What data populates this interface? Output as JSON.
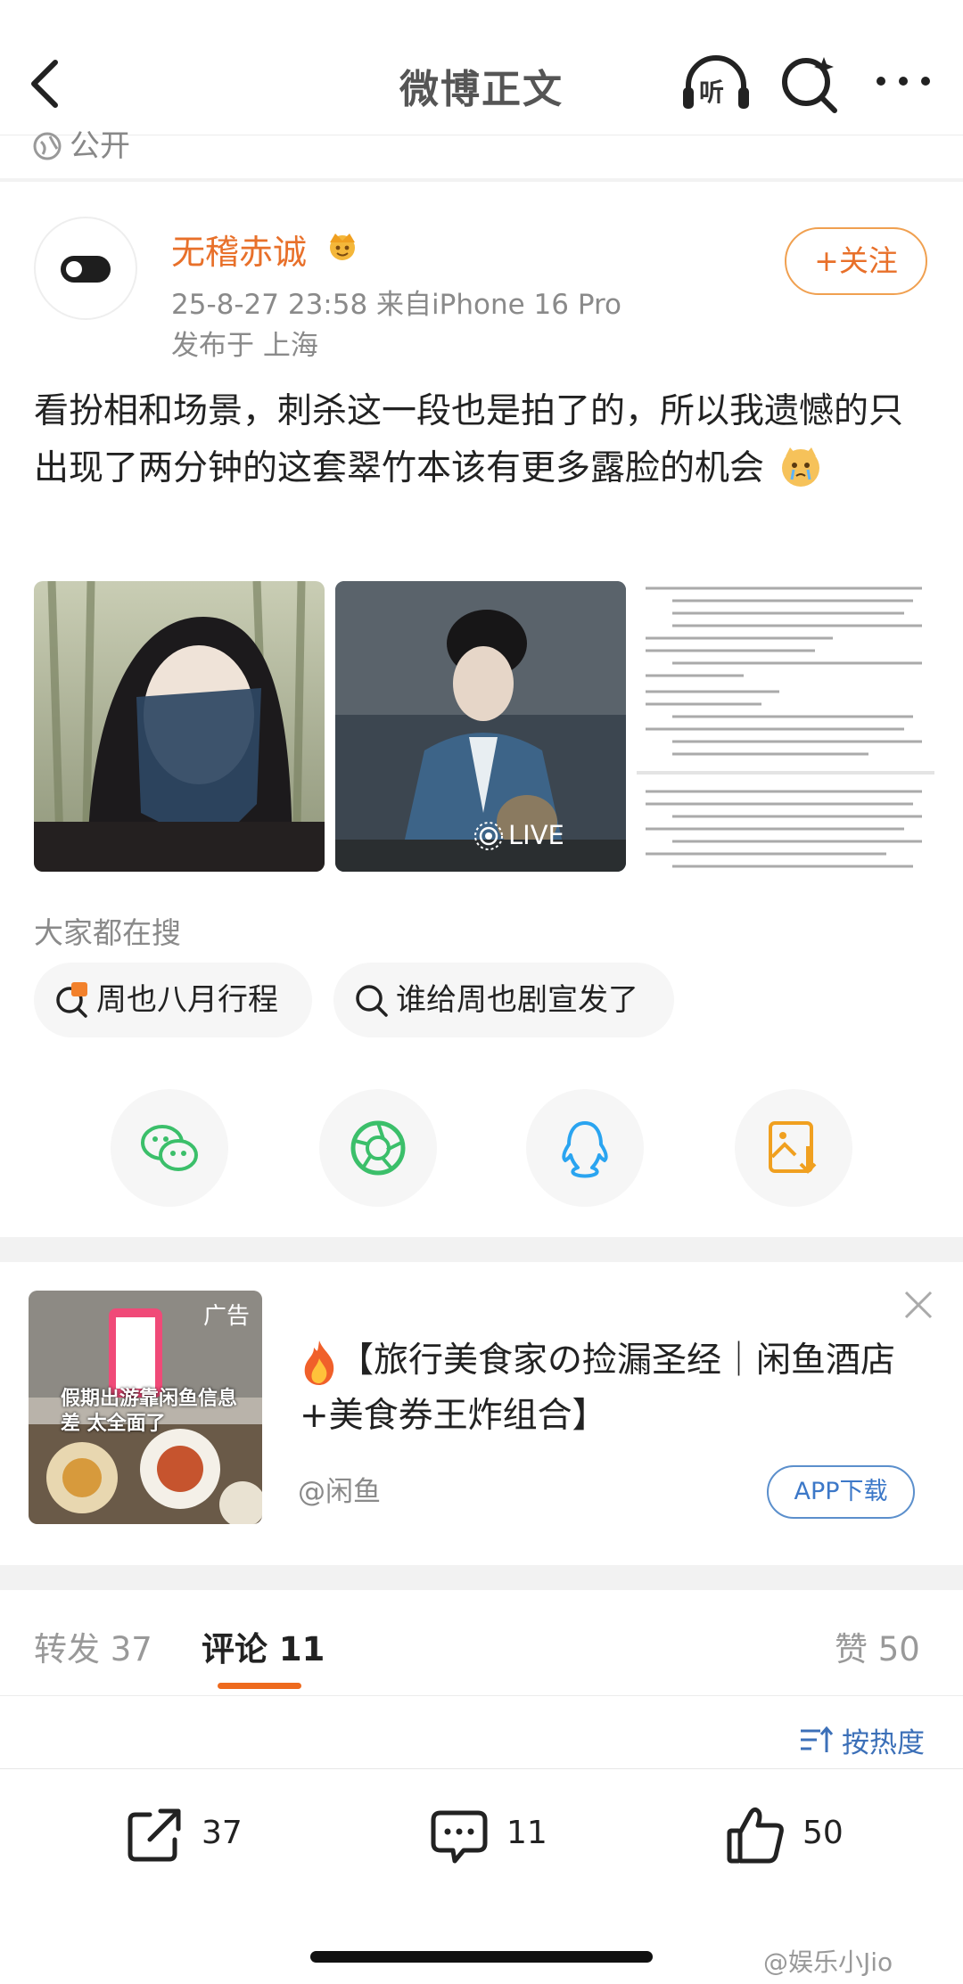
{
  "nav": {
    "title": "微博正文",
    "listen_label": "听"
  },
  "prev_post": {
    "visibility": "公开"
  },
  "post": {
    "username": "无稽赤诚",
    "meta": "25-8-27 23:58  来自iPhone 16 Pro",
    "location": "发布于 上海",
    "follow_label": "+关注",
    "text": "看扮相和场景，刺杀这一段也是拍了的，所以我遗憾的只出现了两分钟的这套翠竹本该有更多露脸的机会",
    "live_label": "LIVE"
  },
  "hot": {
    "title": "大家都在搜",
    "items": [
      "周也八月行程",
      "谁给周也剧宣发了"
    ]
  },
  "share_icons": [
    "wechat-icon",
    "moments-icon",
    "qq-icon",
    "save-image-icon"
  ],
  "ad": {
    "badge": "广告",
    "image_caption": "假期出游靠闲鱼信息差 太全面了",
    "title_line1": "【旅行美食家の捡漏圣经｜闲鱼酒店",
    "title_line2": "+美食券王炸组合】",
    "source": "@闲鱼",
    "button": "APP下载"
  },
  "tabs": {
    "repost": "转发 37",
    "comment": "评论 11",
    "like": "赞 50"
  },
  "sort_label": "按热度",
  "actions": {
    "repost_count": "37",
    "comment_count": "11",
    "like_count": "50"
  },
  "watermark": "@娱乐小Jio",
  "colors": {
    "accent_orange": "#e8702a",
    "link_blue": "#3c70b8",
    "indicator": "#ee6a1e"
  }
}
